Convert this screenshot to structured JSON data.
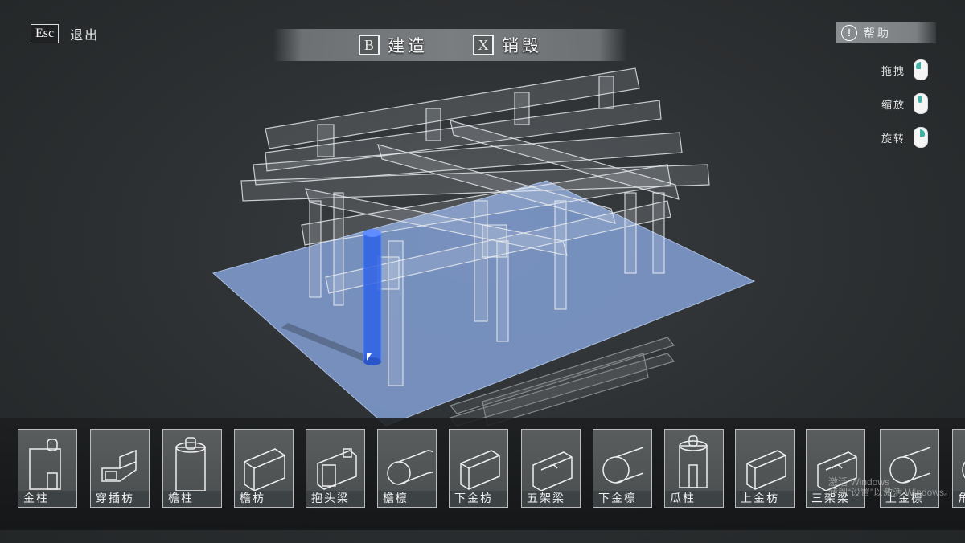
{
  "hud": {
    "exit": {
      "key": "Esc",
      "label": "退出"
    },
    "actions": [
      {
        "key": "B",
        "label": "建造"
      },
      {
        "key": "X",
        "label": "销毁"
      }
    ],
    "help": {
      "icon": "exclamation-icon",
      "label": "帮助"
    },
    "controls": [
      {
        "label": "拖拽",
        "icon": "mouse-left-button-icon"
      },
      {
        "label": "缩放",
        "icon": "mouse-wheel-icon"
      },
      {
        "label": "旋转",
        "icon": "mouse-right-button-icon"
      }
    ]
  },
  "parts": [
    {
      "label": "金柱",
      "icon": "pillar-icon"
    },
    {
      "label": "穿插枋",
      "icon": "tie-beam-icon"
    },
    {
      "label": "檐柱",
      "icon": "eave-pillar-icon"
    },
    {
      "label": "檐枋",
      "icon": "eave-beam-icon"
    },
    {
      "label": "抱头梁",
      "icon": "head-beam-icon"
    },
    {
      "label": "檐檩",
      "icon": "eave-purlin-icon"
    },
    {
      "label": "下金枋",
      "icon": "lower-beam-icon"
    },
    {
      "label": "五架梁",
      "icon": "five-span-beam-icon"
    },
    {
      "label": "下金檩",
      "icon": "lower-purlin-icon"
    },
    {
      "label": "瓜柱",
      "icon": "short-pillar-icon"
    },
    {
      "label": "上金枋",
      "icon": "upper-beam-icon"
    },
    {
      "label": "三架梁",
      "icon": "three-span-beam-icon"
    },
    {
      "label": "上金檩",
      "icon": "upper-purlin-icon"
    },
    {
      "label": "角",
      "icon": "corner-icon"
    }
  ],
  "watermark": {
    "line1": "激活 Windows",
    "line2": "转到“设置”以激活 Windows。"
  },
  "colors": {
    "platform": "#7f9ccf",
    "selected_pillar": "#2f63e6",
    "accent": "#3fb4a6"
  }
}
